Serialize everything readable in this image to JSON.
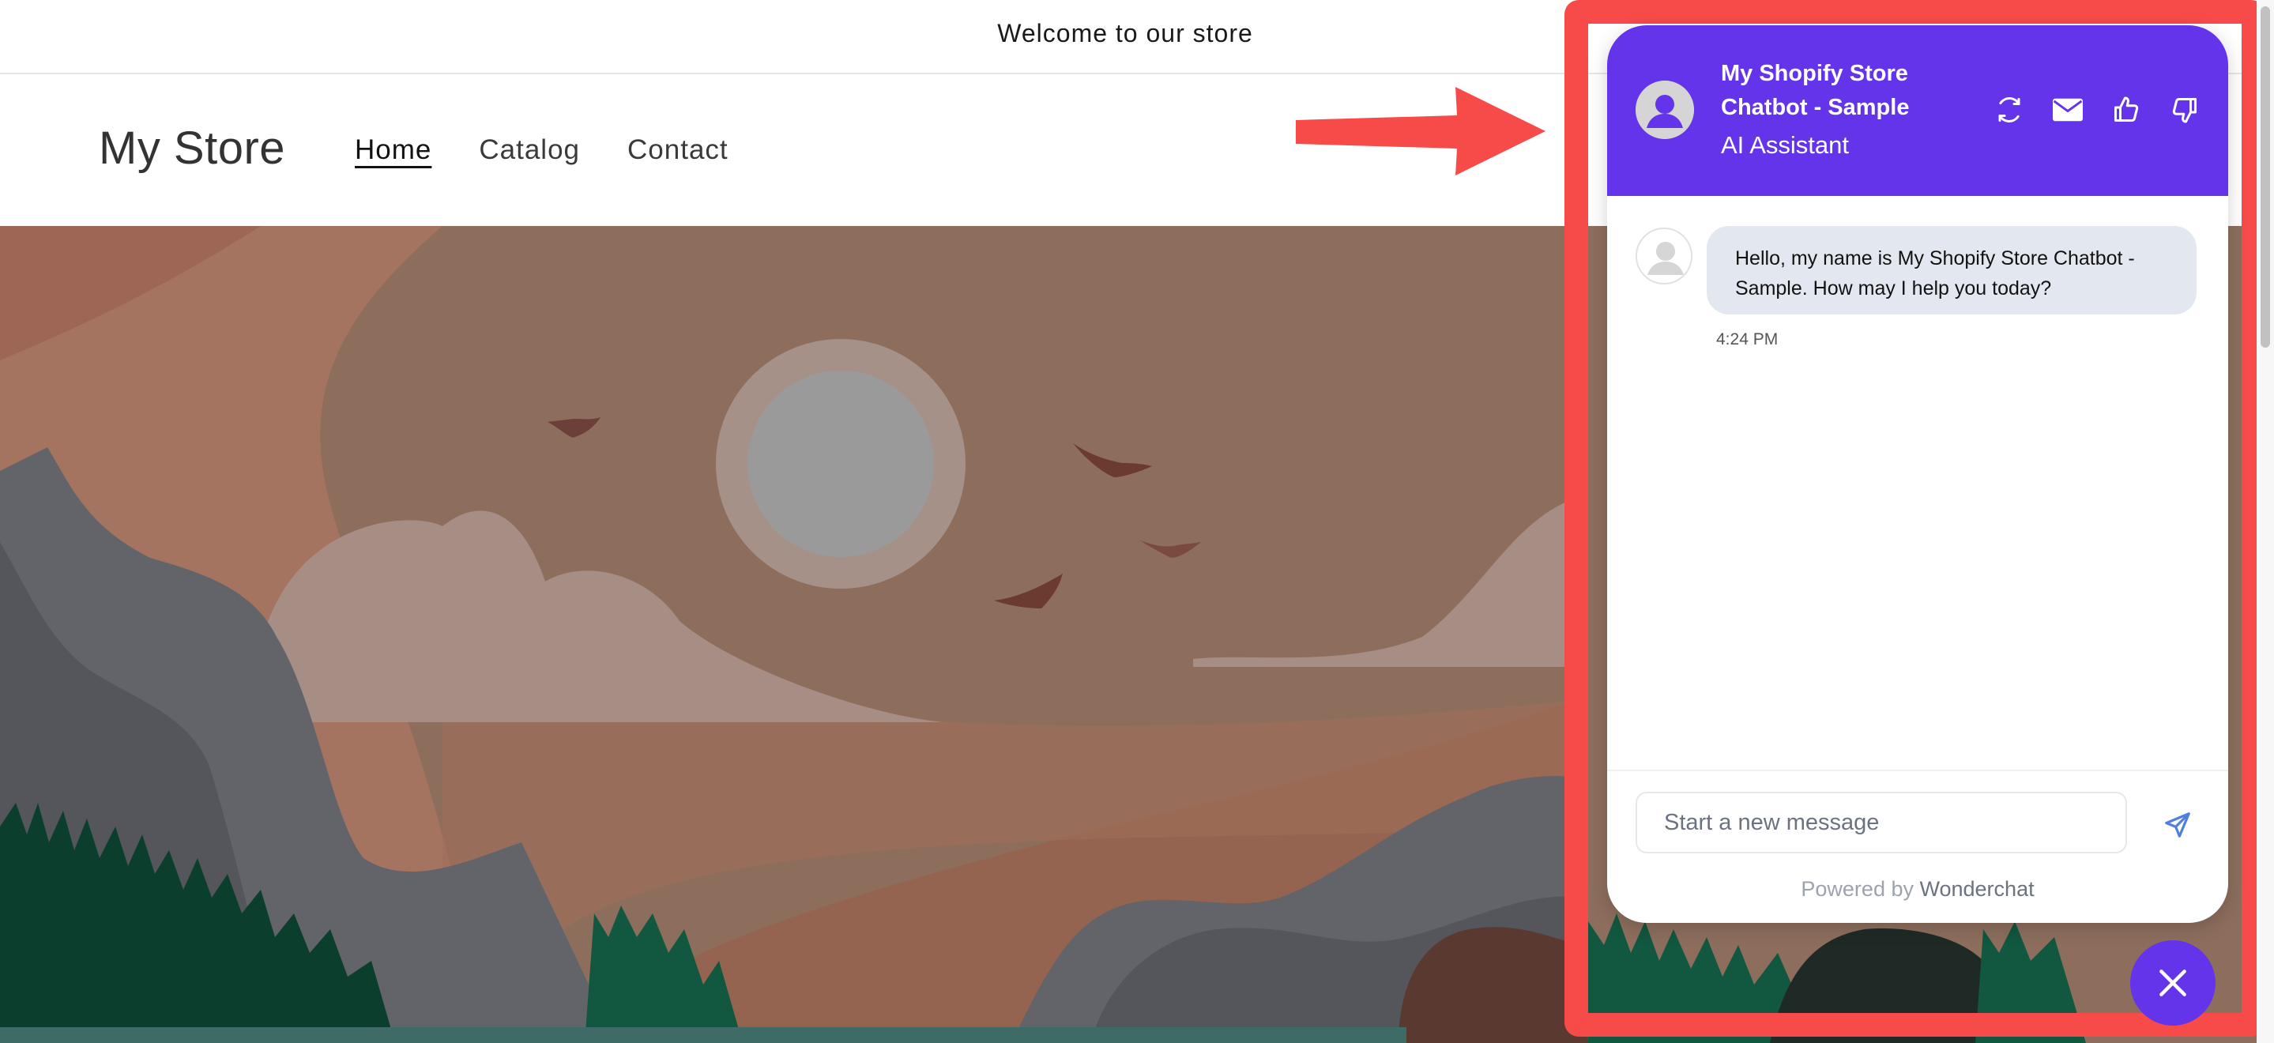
{
  "announcement": {
    "text": "Welcome to our store"
  },
  "header": {
    "logo": "My Store",
    "nav": [
      {
        "label": "Home",
        "active": true
      },
      {
        "label": "Catalog",
        "active": false
      },
      {
        "label": "Contact",
        "active": false
      }
    ]
  },
  "chat": {
    "title": "My Shopify Store Chatbot - Sample",
    "subtitle": "AI Assistant",
    "header_icons": [
      "refresh-icon",
      "email-icon",
      "thumbs-up-icon",
      "thumbs-down-icon"
    ],
    "messages": [
      {
        "sender": "bot",
        "text": "Hello, my name is My Shopify Store Chatbot - Sample. How may I help you today?",
        "time": "4:24 PM"
      }
    ],
    "input": {
      "placeholder": "Start a new message",
      "value": ""
    },
    "powered_by": {
      "prefix": "Powered by",
      "brand": "Wonderchat"
    },
    "accent_color": "#6434ea"
  },
  "annotation": {
    "frame_color": "#f74b49",
    "arrow_color": "#f74b49"
  }
}
